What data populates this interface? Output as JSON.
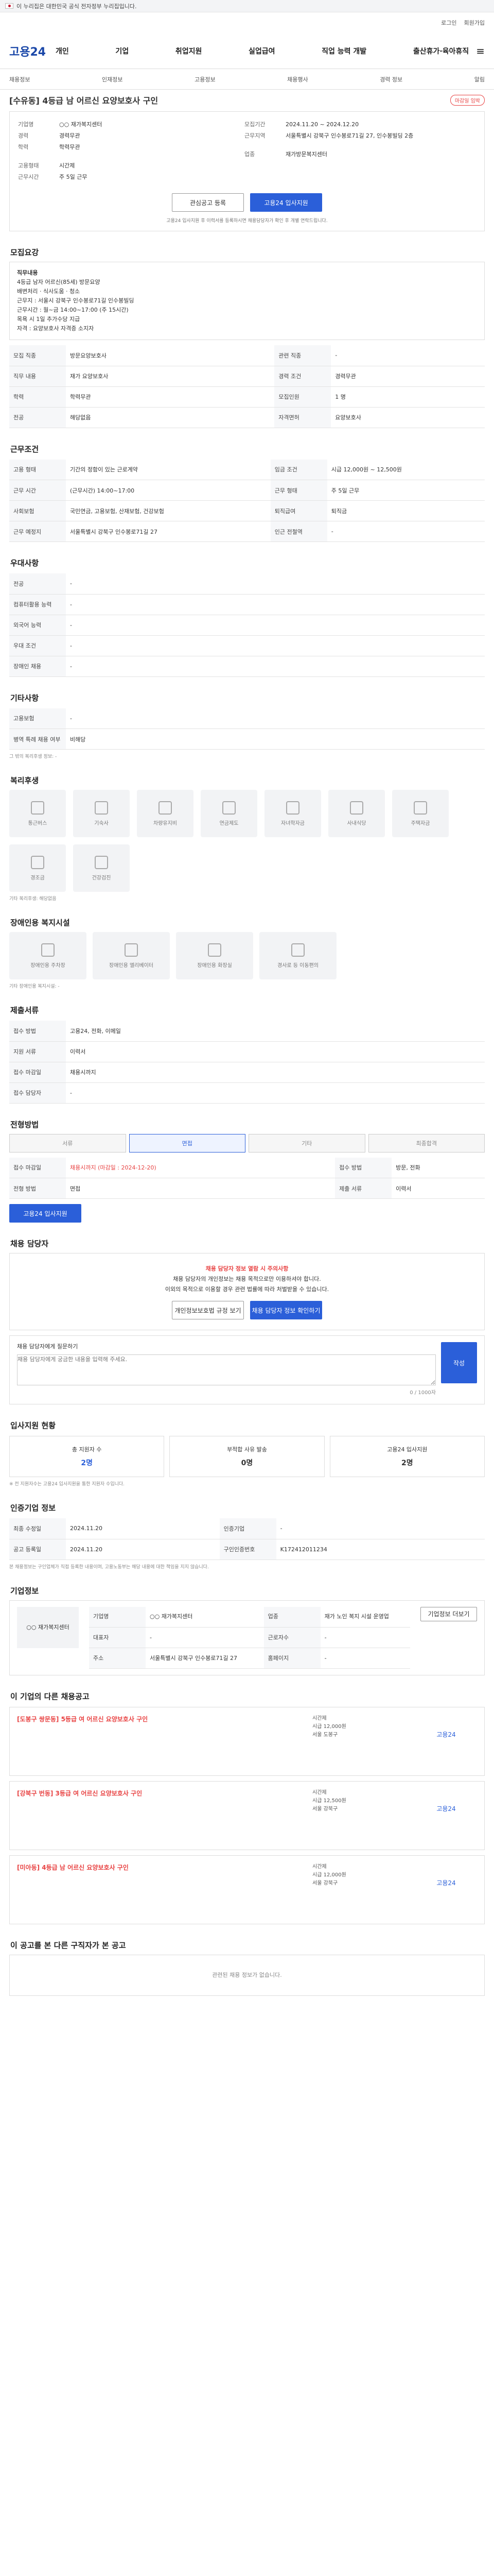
{
  "gov": {
    "flag": "taegukgi-icon",
    "text": "이 누리집은 대한민국 공식 전자정부 누리집입니다."
  },
  "util": [
    "로그인",
    "회원가입"
  ],
  "header": {
    "logo": "고용24",
    "menu": [
      "개인",
      "기업",
      "취업지원",
      "실업급여",
      "직업 능력 개발",
      "출산휴가·육아휴직"
    ]
  },
  "subnav": [
    "채용정보",
    "인재정보",
    "고용정보",
    "채용행사",
    "경력 정보",
    "알림"
  ],
  "posting": {
    "title": "[수유동] 4등급 남 어르신 요양보호사 구인",
    "badge": "마감일 임박",
    "company": {
      "label": "기업명",
      "name": "○○ 재가복지센터",
      "type_label": "업종",
      "type": "재가방문복지센터"
    },
    "period": {
      "label": "모집기간",
      "value": "2024.11.20 ~ 2024.12.20"
    },
    "location": {
      "label": "근무지역",
      "value": "서울특별시 강북구 인수봉로71길 27, 인수봉빌딩 2층"
    },
    "keys": [
      {
        "k": "경력",
        "v": "경력무관"
      },
      {
        "k": "학력",
        "v": "학력무관"
      },
      {
        "k": "고용형태",
        "v": "시간제"
      },
      {
        "k": "근무시간",
        "v": "주 5일 근무"
      }
    ],
    "btn_interest": "관심공고 등록",
    "btn_apply": "고용24 입사지원",
    "apply_note": "고용24 입사지원 후 이력서를 등록하시면 채용담당자가 확인 후 개별 연락드립니다."
  },
  "sections": {
    "recruit": "모집요강",
    "conditions": "근무조건",
    "welfare": "우대사항",
    "etc": "기타사항",
    "facilities": "복리후생",
    "disabled": "장애인용 복지시설",
    "forms": "제출서류",
    "process": "전형방법",
    "contact": "채용 담당자",
    "status": "입사지원 현황",
    "history": "인증기업 정보",
    "company": "기업정보",
    "other": "이 기업의 다른 채용공고",
    "scrap": "이 공고를 본 다른 구직자가 본 공고"
  },
  "recruit": {
    "box_title": "직무내용",
    "lines": [
      "4등급 남자 어르신(85세) 방문요양",
      "배변처리 · 식사도움 · 청소",
      "근무지 : 서울시 강북구 인수봉로71길 인수봉빌딩",
      "근무시간 : 월~금 14:00~17:00 (주 15시간)",
      "목욕 시 1일 추가수당 지급",
      "자격 : 요양보호사 자격증 소지자"
    ],
    "rows": [
      [
        "모집 직종",
        "방문요양보호사",
        "관련 직종",
        "-"
      ],
      [
        "직무 내용",
        "재가 요양보호사",
        "경력 조건",
        "경력무관"
      ],
      [
        "학력",
        "학력무관",
        "모집인원",
        "1 명"
      ],
      [
        "전공",
        "해당없음",
        "자격면허",
        "요양보호사"
      ]
    ]
  },
  "cond": {
    "rows": [
      [
        "고용 형태",
        "기간의 정함이 있는 근로계약",
        "임금 조건",
        "시급 12,000원 ~ 12,500원"
      ],
      [
        "근무 시간",
        "(근무시간) 14:00~17:00",
        "근무 형태",
        "주 5일 근무"
      ],
      [
        "사회보험",
        "국민연금, 고용보험, 산재보험, 건강보험",
        "퇴직급여",
        "퇴직금"
      ],
      [
        "근무 예정지",
        "서울특별시 강북구 인수봉로71길 27",
        "인근 전철역",
        "-"
      ]
    ]
  },
  "welfare": {
    "rows": [
      [
        "전공",
        "-"
      ],
      [
        "컴퓨터활용 능력",
        "-"
      ],
      [
        "외국어 능력",
        "-"
      ],
      [
        "우대 조건",
        "-"
      ],
      [
        "장애인 채용",
        "-"
      ]
    ]
  },
  "etc": {
    "rows": [
      [
        "고용보험",
        "-"
      ],
      [
        "병역 특례 채용 여부",
        "비해당"
      ]
    ],
    "hint": "그 밖의 복리후생 정보: -"
  },
  "facilities": [
    "통근버스",
    "기숙사",
    "차량유지비",
    "연금제도",
    "자녀학자금",
    "사내식당",
    "주택자금",
    "경조금",
    "건강검진"
  ],
  "facilities_hint": "기타 복리후생: 해당없음",
  "disabled": [
    "장애인용 주차장",
    "장애인용 엘리베이터",
    "장애인용 화장실",
    "경사로 등 이동편의"
  ],
  "disabled_hint": "기타 장애인용 복지시설: -",
  "forms": {
    "rows": [
      [
        "접수 방법",
        "고용24, 전화, 이메일"
      ],
      [
        "지원 서류",
        "이력서"
      ],
      [
        "접수 마감일",
        "채용시까지"
      ],
      [
        "접수 담당자",
        "-"
      ]
    ]
  },
  "process": {
    "steps": [
      "서류",
      "면접",
      "기타",
      "최종합격"
    ],
    "rows": [
      [
        "접수 마감일",
        "채용시까지 (마감일 : 2024-12-20)",
        "접수 방법",
        "방문, 전화"
      ],
      [
        "전형 방법",
        "면접",
        "제출 서류",
        "이력서"
      ]
    ],
    "apply": "고용24 입사지원"
  },
  "contact": {
    "alert": "채용 담당자 정보 열람 시 주의사항",
    "line1": "채용 담당자의 개인정보는 채용 목적으로만 이용하셔야 합니다.",
    "line2": "이외의 목적으로 이용할 경우 관련 법률에 따라 처벌받을 수 있습니다.",
    "btn1": "개인정보보호법 규정 보기",
    "btn2": "채용 담당자 정보 확인하기",
    "q_label": "채용 담당자에게 질문하기",
    "q_placeholder": "채용 담당자에게 궁금한 내용을 입력해 주세요.",
    "q_count": "0 / 1000자",
    "q_btn": "작성"
  },
  "stat": {
    "cards": [
      {
        "t": "총 지원자 수",
        "v": "2명"
      },
      {
        "t": "부적합 사유 발송",
        "v": "0명"
      },
      {
        "t": "고용24 입사지원",
        "v": "2명"
      }
    ],
    "note": "※ 전 지원자수는 고용24 입사지원을 통한 지원자 수입니다."
  },
  "history": {
    "rows": [
      [
        "최종 수정일",
        "2024.11.20",
        "인증기업",
        "-"
      ],
      [
        "공고 등록일",
        "2024.11.20",
        "구인인증번호",
        "K172412011234"
      ]
    ],
    "note": "본 채용정보는 구인업체가 직접 등록한 내용이며, 고용노동부는 해당 내용에 대한 책임을 지지 않습니다."
  },
  "company": {
    "name": "○○ 재가복지센터",
    "rows": [
      [
        "기업명",
        "○○ 재가복지센터",
        "업종",
        "재가 노인 복지 시설 운영업"
      ],
      [
        "대표자",
        "-",
        "근로자수",
        "-"
      ],
      [
        "주소",
        "서울특별시 강북구 인수봉로71길 27",
        "홈페이지",
        "-"
      ]
    ],
    "btn": "기업정보 더보기"
  },
  "others": [
    {
      "title": "[도봉구 쌍문동] 5등급 여 어르신 요양보호사 구인",
      "cond": [
        "시간제",
        "시급 12,000원",
        "서울 도봉구"
      ]
    },
    {
      "title": "[강북구 번동] 3등급 여 어르신 요양보호사 구인",
      "cond": [
        "시간제",
        "시급 12,500원",
        "서울 강북구"
      ]
    },
    {
      "title": "[미아동] 4등급 남 어르신 요양보호사 구인",
      "cond": [
        "시간제",
        "시급 12,000원",
        "서울 강북구"
      ]
    }
  ],
  "footer_empty": "관련된 채용 정보가 없습니다."
}
